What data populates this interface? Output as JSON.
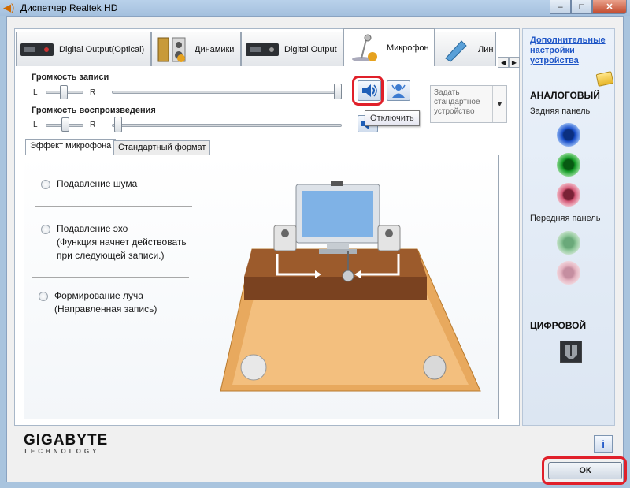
{
  "window": {
    "title": "Диспетчер Realtek HD"
  },
  "device_tabs": [
    {
      "label": "Digital Output(Optical)"
    },
    {
      "label": "Динамики"
    },
    {
      "label": "Digital Output"
    },
    {
      "label": "Микрофон"
    },
    {
      "label": "Лин"
    }
  ],
  "record_volume": {
    "label": "Громкость записи",
    "left": "L",
    "right": "R"
  },
  "playback_volume": {
    "label": "Громкость воспроизведения",
    "left": "L",
    "right": "R"
  },
  "tooltip": "Отключить",
  "default_device": "Задать стандартное устройство",
  "effect_tabs": [
    "Эффект микрофона",
    "Стандартный формат"
  ],
  "options": {
    "noise": "Подавление шума",
    "echo_line1": "Подавление эхо",
    "echo_line2": "(Функция начнет действовать",
    "echo_line3": "при следующей записи.)",
    "beam_line1": "Формирование луча",
    "beam_line2": "(Направленная запись)"
  },
  "right_panel": {
    "link": "Дополнительные настройки устройства",
    "analog": "АНАЛОГОВЫЙ",
    "rear": "Задняя панель",
    "front": "Передняя панель",
    "digital": "ЦИФРОВОЙ",
    "jack_colors": {
      "blue": "#1a4fc9",
      "green": "#159c28",
      "pink": "#d45a78",
      "green_dim": "#8fc79a",
      "pink_dim": "#e4b3c0"
    }
  },
  "brand": {
    "name": "GIGABYTE",
    "sub": "TECHNOLOGY"
  },
  "buttons": {
    "ok": "ОК",
    "step": "2"
  }
}
